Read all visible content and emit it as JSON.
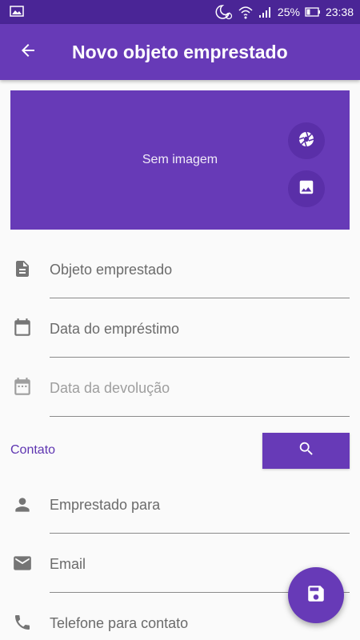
{
  "status_bar": {
    "battery": "25%",
    "time": "23:38",
    "icons": [
      "image-icon",
      "moon-alarm-icon",
      "wifi-icon",
      "signal-icon",
      "battery-icon"
    ]
  },
  "app_bar": {
    "title": "Novo objeto emprestado",
    "back_icon": "arrow-back-icon"
  },
  "image_panel": {
    "placeholder_text": "Sem imagem",
    "camera_icon": "camera-icon",
    "gallery_icon": "gallery-icon"
  },
  "fields": {
    "object": {
      "placeholder": "Objeto emprestado",
      "value": "",
      "icon": "document-icon"
    },
    "loan_date": {
      "placeholder": "Data do empréstimo",
      "value": "",
      "icon": "calendar-icon"
    },
    "return_date": {
      "placeholder": "Data da devolução",
      "value": "",
      "icon": "calendar-icon"
    }
  },
  "contact": {
    "section_label": "Contato",
    "search_icon": "search-icon",
    "lent_to": {
      "placeholder": "Emprestado para",
      "value": "",
      "icon": "person-icon"
    },
    "email": {
      "placeholder": "Email",
      "value": "",
      "icon": "email-icon"
    },
    "phone": {
      "placeholder": "Telefone para contato",
      "value": "",
      "icon": "phone-icon"
    }
  },
  "fab": {
    "icon": "save-icon"
  },
  "colors": {
    "primary": "#673ab7",
    "primary_dark": "#4a2596",
    "accent_text": "#5e35b1",
    "background": "#fafafa"
  }
}
